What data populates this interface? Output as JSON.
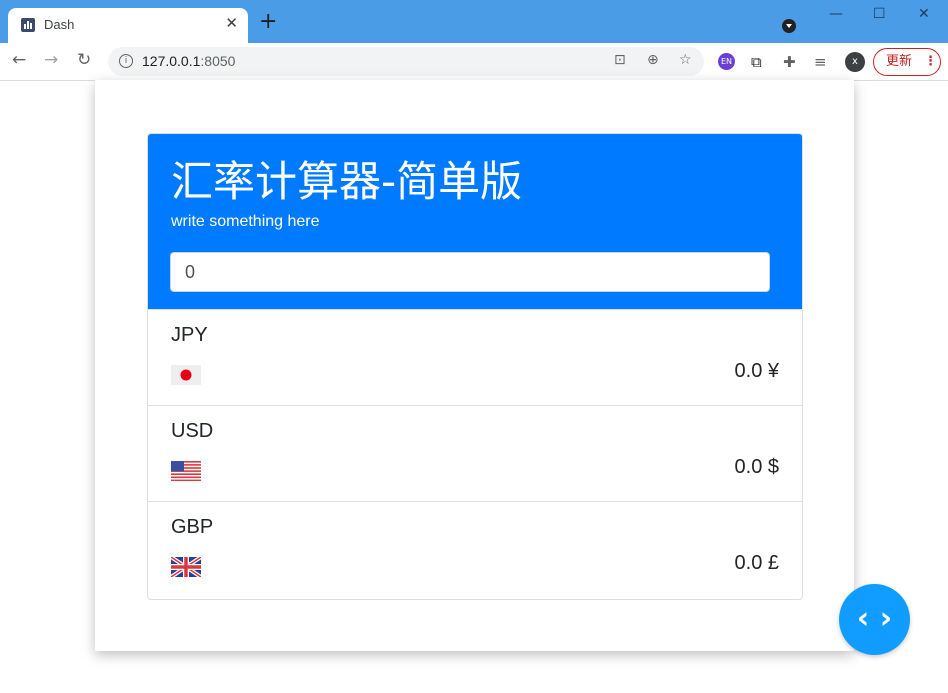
{
  "browser": {
    "tab_title": "Dash",
    "tab_close": "✕",
    "new_tab": "+",
    "url_host": "127.0.0.1",
    "url_port": ":8050",
    "update_label": "更新",
    "profile_initial": "x",
    "ext_en_label": "EN"
  },
  "app": {
    "title": "汇率计算器-简单版",
    "subtitle": "write something here",
    "amount_value": "0",
    "code_toggle_label": "‹ ›",
    "accent_color": "#007bff"
  },
  "currencies": [
    {
      "code": "JPY",
      "value": "0.0 ¥",
      "flag": "japan-flag-icon"
    },
    {
      "code": "USD",
      "value": "0.0 $",
      "flag": "usa-flag-icon"
    },
    {
      "code": "GBP",
      "value": "0.0 £",
      "flag": "uk-flag-icon"
    }
  ]
}
